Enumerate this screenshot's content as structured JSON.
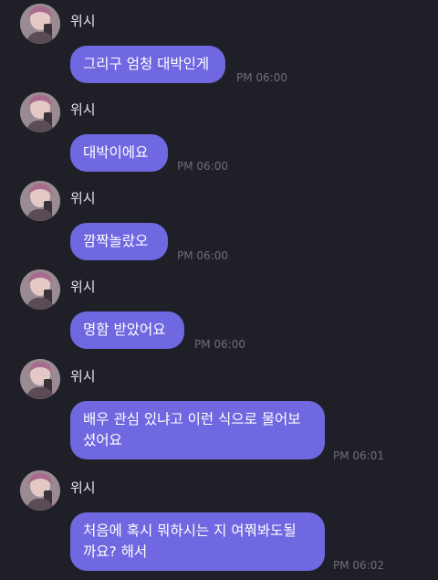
{
  "messages": [
    {
      "sender": "위시",
      "text": "그리구 엄청 대박인게",
      "time": "PM 06:00"
    },
    {
      "sender": "위시",
      "text": "대박이에요",
      "time": "PM 06:00"
    },
    {
      "sender": "위시",
      "text": "깜짝놀랐오",
      "time": "PM 06:00"
    },
    {
      "sender": "위시",
      "text": "명함 받았어요",
      "time": "PM 06:00"
    },
    {
      "sender": "위시",
      "text": "배우 관심 있냐고 이런 식으로 물어보\n셨어요",
      "time": "PM 06:01"
    },
    {
      "sender": "위시",
      "text": "처음에 혹시 뭐하시는 지 여쭤봐도될\n까요? 해서",
      "time": "PM 06:02"
    }
  ],
  "colors": {
    "background": "#1f1f28",
    "bubble": "#7068e0",
    "timestamp": "#6e6e76"
  },
  "icons": {
    "avatar": "profile-photo"
  }
}
